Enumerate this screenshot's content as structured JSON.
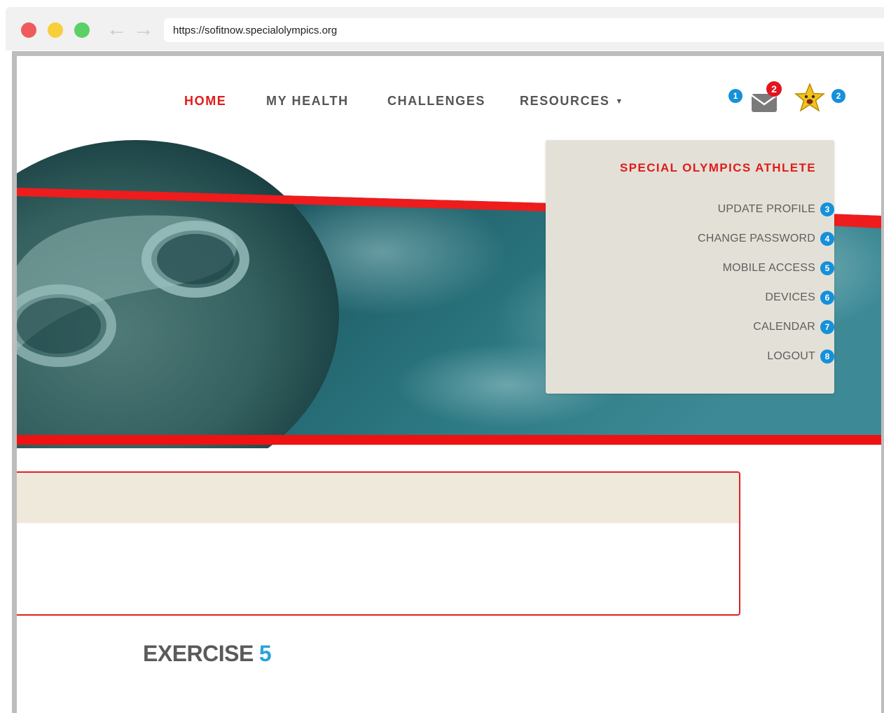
{
  "browser": {
    "url": "https://sofitnow.specialolympics.org"
  },
  "nav": {
    "items": [
      {
        "label": "HOME",
        "active": true
      },
      {
        "label": "MY HEALTH",
        "active": false
      },
      {
        "label": "CHALLENGES",
        "active": false
      },
      {
        "label": "RESOURCES",
        "active": false,
        "has_dropdown": true
      }
    ]
  },
  "header_icons": {
    "messages_marker": "1",
    "messages_count": "2",
    "messages_icon": "envelope-icon",
    "profile_marker": "2",
    "profile_icon": "star-avatar-icon"
  },
  "dropdown": {
    "title": "SPECIAL OLYMPICS ATHLETE",
    "items": [
      {
        "label": "UPDATE PROFILE",
        "marker": "3"
      },
      {
        "label": "CHANGE PASSWORD",
        "marker": "4"
      },
      {
        "label": "MOBILE ACCESS",
        "marker": "5"
      },
      {
        "label": "DEVICES",
        "marker": "6"
      },
      {
        "label": "CALENDAR",
        "marker": "7"
      },
      {
        "label": "LOGOUT",
        "marker": "8"
      }
    ]
  },
  "content": {
    "exercise_label": "EXERCISE",
    "exercise_number": "5"
  },
  "colors": {
    "brand_red": "#e01b1b",
    "marker_blue": "#1690d9",
    "dropdown_bg": "#e3e1d7",
    "card_header_bg": "#efe9dc",
    "exercise_number": "#27a3dc"
  }
}
